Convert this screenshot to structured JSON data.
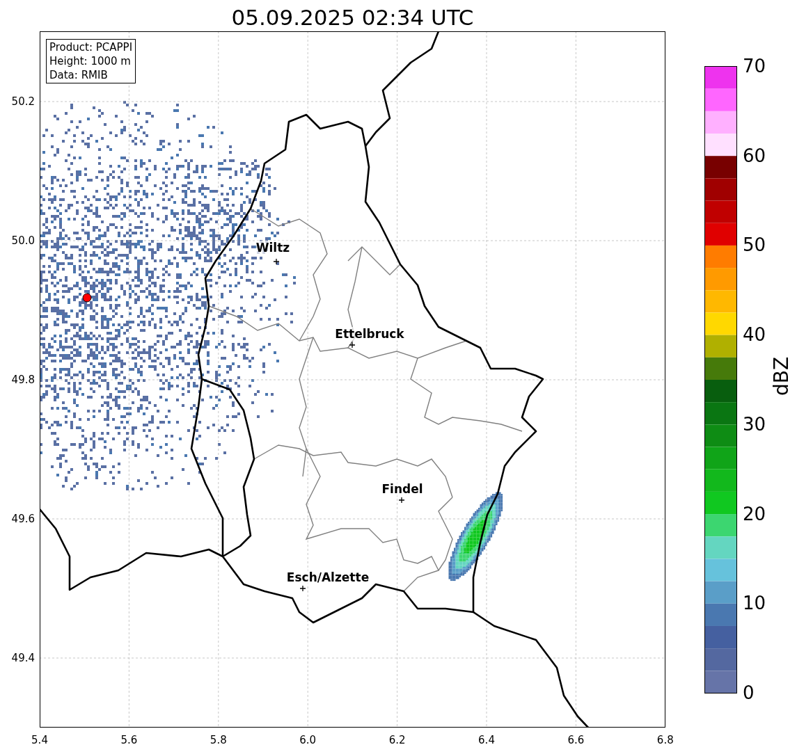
{
  "title": "05.09.2025 02:34 UTC",
  "info_box": [
    "Product: PCAPPI",
    "Height: 1000 m",
    "Data: RMIB"
  ],
  "map": {
    "x_ticks": [
      "5.4",
      "5.6",
      "5.8",
      "6.0",
      "6.2",
      "6.4",
      "6.6",
      "6.8"
    ],
    "y_ticks": [
      "50.2",
      "50.0",
      "49.8",
      "49.6",
      "49.4"
    ],
    "places": [
      {
        "name": "Wiltz"
      },
      {
        "name": "Ettelbruck"
      },
      {
        "name": "Findel"
      },
      {
        "name": "Esch/Alzette"
      }
    ]
  },
  "colorbar": {
    "label": "dBZ",
    "ticks": [
      "70",
      "60",
      "50",
      "40",
      "30",
      "20",
      "10",
      "0"
    ],
    "bins": [
      {
        "color": "#ee33ee"
      },
      {
        "color": "#ff66ff"
      },
      {
        "color": "#ffb0ff"
      },
      {
        "color": "#ffe0ff"
      },
      {
        "color": "#780000"
      },
      {
        "color": "#a00000"
      },
      {
        "color": "#c00000"
      },
      {
        "color": "#e00000"
      },
      {
        "color": "#ff7c00"
      },
      {
        "color": "#ff9a00"
      },
      {
        "color": "#ffb800"
      },
      {
        "color": "#ffd800"
      },
      {
        "color": "#b0b000"
      },
      {
        "color": "#467a0a"
      },
      {
        "color": "#085e0e"
      },
      {
        "color": "#0a7612"
      },
      {
        "color": "#0e8c14"
      },
      {
        "color": "#10a418"
      },
      {
        "color": "#12b81c"
      },
      {
        "color": "#10c820"
      },
      {
        "color": "#3cd670"
      },
      {
        "color": "#64d6c0"
      },
      {
        "color": "#66c2dc"
      },
      {
        "color": "#5a9ec8"
      },
      {
        "color": "#4a78b0"
      },
      {
        "color": "#4560a0"
      },
      {
        "color": "#5468a0"
      },
      {
        "color": "#6674a8"
      }
    ]
  }
}
